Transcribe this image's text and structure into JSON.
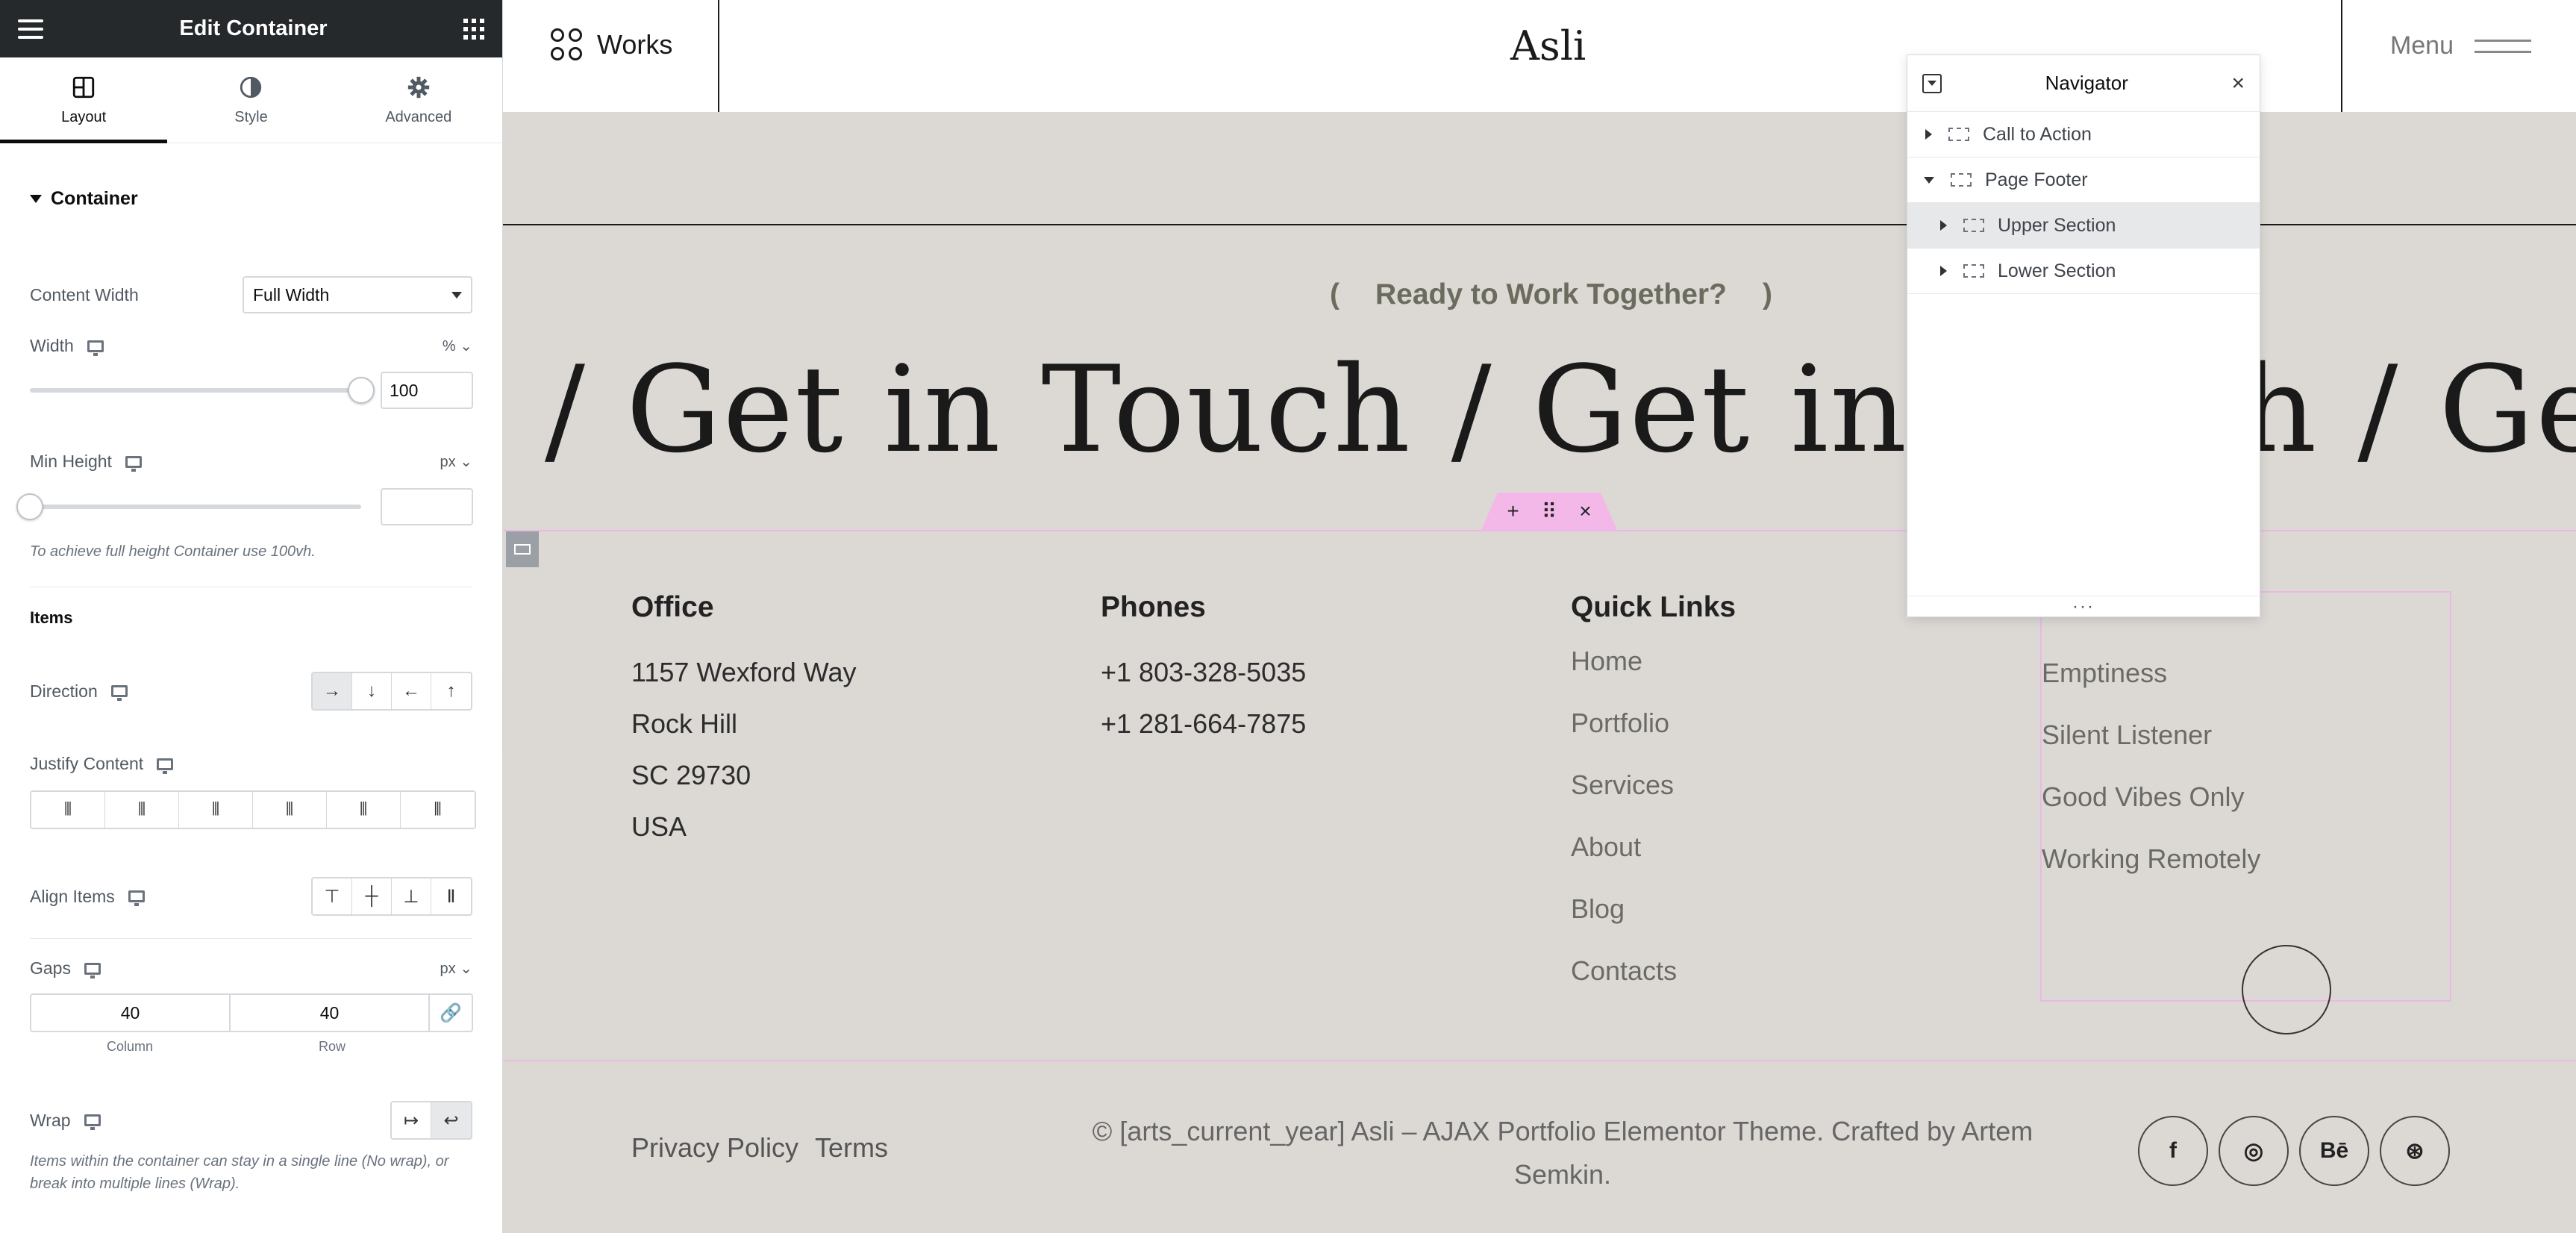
{
  "editor": {
    "title": "Edit Container",
    "tabs": [
      {
        "label": "Layout",
        "icon": "layout-icon"
      },
      {
        "label": "Style",
        "icon": "style-half-circle-icon"
      },
      {
        "label": "Advanced",
        "icon": "gear-icon"
      }
    ],
    "section_title": "Container",
    "content_width": {
      "label": "Content Width",
      "value": "Full Width"
    },
    "width": {
      "label": "Width",
      "unit": "%",
      "value": "100",
      "slider_fraction": 1.0
    },
    "min_height": {
      "label": "Min Height",
      "unit": "px",
      "value": "",
      "slider_fraction": 0.0,
      "help": "To achieve full height Container use 100vh."
    },
    "items_title": "Items",
    "direction": {
      "label": "Direction",
      "options": [
        "→",
        "↓",
        "←",
        "↑"
      ],
      "selected": 0
    },
    "justify_content": {
      "label": "Justify Content"
    },
    "align_items": {
      "label": "Align Items"
    },
    "gaps": {
      "label": "Gaps",
      "unit": "px",
      "column": "40",
      "row": "40",
      "column_caption": "Column",
      "row_caption": "Row"
    },
    "wrap": {
      "label": "Wrap",
      "help": "Items within the container can stay in a single line (No wrap), or break into multiple lines (Wrap)."
    }
  },
  "site": {
    "works_label": "Works",
    "logo": "Asli",
    "menu_label": "Menu",
    "cta": {
      "open_paren": "(",
      "text": "Ready to Work Together?",
      "close_paren": ")"
    },
    "marquee_text": "/  Get in Touch  /  Get in Touch  /  Get in Touch",
    "office": {
      "title": "Office",
      "lines": [
        "1157 Wexford Way",
        "Rock Hill",
        "SC 29730",
        "USA"
      ]
    },
    "phones": {
      "title": "Phones",
      "lines": [
        "+1 803-328-5035",
        "+1 281-664-7875"
      ]
    },
    "quick_links": {
      "title": "Quick Links",
      "links": [
        "Home",
        "Portfolio",
        "Services",
        "About",
        "Blog",
        "Contacts"
      ]
    },
    "posts": {
      "links": [
        "Emptiness",
        "Silent Listener",
        "Good Vibes Only",
        "Working Remotely"
      ]
    },
    "legal": {
      "privacy": "Privacy Policy",
      "terms": "Terms"
    },
    "copyright": "© [arts_current_year] Asli – AJAX Portfolio Elementor Theme. Crafted by Artem Semkin.",
    "social": [
      {
        "label": "f",
        "icon": "facebook-icon"
      },
      {
        "label": "◎",
        "icon": "instagram-icon"
      },
      {
        "label": "Bē",
        "icon": "behance-icon"
      },
      {
        "label": "⊛",
        "icon": "dribbble-icon"
      }
    ],
    "handle": {
      "add": "+",
      "move": "⠿",
      "close": "×"
    }
  },
  "navigator": {
    "title": "Navigator",
    "close": "×",
    "items": [
      {
        "label": "Call to Action",
        "expanded": false,
        "level": 0
      },
      {
        "label": "Page Footer",
        "expanded": true,
        "level": 0
      },
      {
        "label": "Upper Section",
        "expanded": false,
        "level": 1,
        "highlighted": true
      },
      {
        "label": "Lower Section",
        "expanded": false,
        "level": 1
      }
    ],
    "footer": "···"
  },
  "colors": {
    "accent_pink": "#e9b9e4",
    "panel_dark": "#26292c",
    "canvas_bg": "#dcd9d5"
  }
}
